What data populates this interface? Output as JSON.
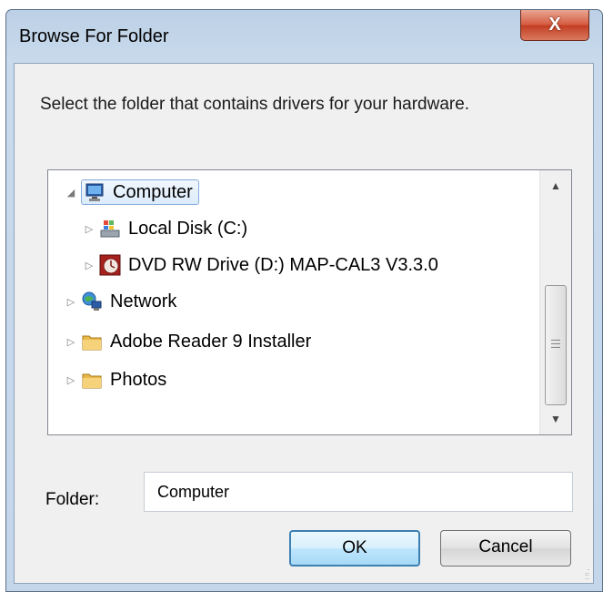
{
  "window": {
    "title": "Browse For Folder",
    "close_glyph": "X"
  },
  "prompt": "Select the folder that contains drivers for your hardware.",
  "tree": {
    "items": [
      {
        "label": "Computer",
        "icon": "computer-icon",
        "expanded": true,
        "selected": true
      },
      {
        "label": "Local Disk (C:)",
        "icon": "drive-icon",
        "expanded": false
      },
      {
        "label": "DVD RW Drive (D:) MAP-CAL3 V3.3.0",
        "icon": "dvd-icon",
        "expanded": false
      },
      {
        "label": "Network",
        "icon": "network-icon",
        "expanded": false
      },
      {
        "label": "Adobe Reader 9 Installer",
        "icon": "folder-icon",
        "expanded": false
      },
      {
        "label": "Photos",
        "icon": "folder-icon",
        "expanded": false
      }
    ]
  },
  "folder": {
    "label": "Folder:",
    "value": "Computer"
  },
  "buttons": {
    "ok": "OK",
    "cancel": "Cancel"
  },
  "colors": {
    "selection_border": "#84acdd",
    "close_red": "#c23c22",
    "ok_border": "#3c7fb1"
  }
}
